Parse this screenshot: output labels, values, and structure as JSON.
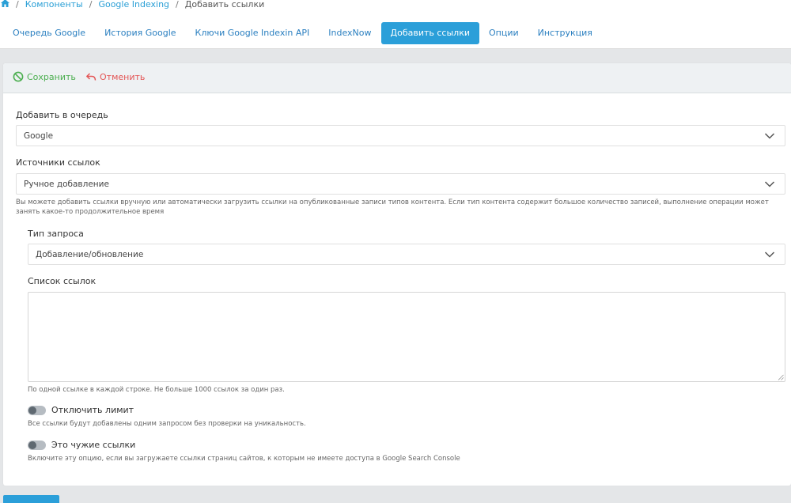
{
  "breadcrumb": {
    "home_icon": "home-icon",
    "items": [
      "Компоненты",
      "Google Indexing",
      "Добавить ссылки"
    ]
  },
  "tabs": [
    {
      "label": "Очередь Google",
      "active": false
    },
    {
      "label": "История Google",
      "active": false
    },
    {
      "label": "Ключи Google Indexin API",
      "active": false
    },
    {
      "label": "IndexNow",
      "active": false
    },
    {
      "label": "Добавить ссылки",
      "active": true
    },
    {
      "label": "Опции",
      "active": false
    },
    {
      "label": "Инструкция",
      "active": false
    }
  ],
  "toolbar": {
    "save_label": "Сохранить",
    "cancel_label": "Отменить",
    "save_icon": "save-icon",
    "cancel_icon": "undo-icon"
  },
  "form": {
    "queue_label": "Добавить в очередь",
    "queue_value": "Google",
    "source_label": "Источники ссылок",
    "source_value": "Ручное добавление",
    "source_hint": "Вы можете добавить ссылки вручную или автоматически загрузить ссылки на опубликованные записи типов контента. Если тип контента содержит большое количество записей, выполнение операции может занять какое-то продолжительное время",
    "request_type_label": "Тип запроса",
    "request_type_value": "Добавление/обновление",
    "links_label": "Список ссылок",
    "links_value": "",
    "links_hint": "По одной ссылке в каждой строке. Не больше 1000 ссылок за один раз.",
    "limit_label": "Отключить лимит",
    "limit_enabled": false,
    "limit_hint": "Все ссылки будут добавлены одним запросом без проверки на уникальность.",
    "foreign_label": "Это чужие ссылки",
    "foreign_enabled": false,
    "foreign_hint": "Включите эту опцию, если вы загружаете ссылки страниц сайтов, к которым не имеете доступа в Google Search Console"
  },
  "colors": {
    "accent": "#2b9fd9",
    "link": "#2a7fc0",
    "save": "#4caf50",
    "cancel": "#e45656"
  }
}
